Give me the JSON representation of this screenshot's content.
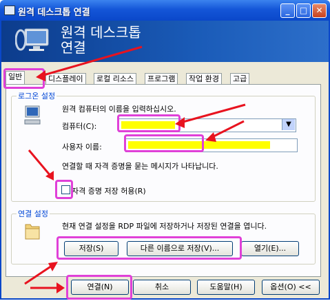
{
  "window": {
    "title": "원격 데스크톱 연결",
    "minimize": "_",
    "maximize": "□",
    "close": "✕"
  },
  "banner": {
    "title": "원격 데스크톱\n연결"
  },
  "tabs": [
    {
      "label": "일반"
    },
    {
      "label": "디스플레이"
    },
    {
      "label": "로컬 리소스"
    },
    {
      "label": "프로그램"
    },
    {
      "label": "작업 환경"
    },
    {
      "label": "고급"
    }
  ],
  "logon": {
    "group_title": "로그온 설정",
    "instruction": "원격 컴퓨터의 이름을 입력하십시오.",
    "computer_label": "컴퓨터(C):",
    "computer_value": "",
    "username_label": "사용자 이름:",
    "username_value": "",
    "credential_note": "연결할 때 자격 증명을 묻는 메시지가 나타납니다.",
    "allow_save_label": "자격 증명 저장 허용(R)",
    "allow_save_checked": false
  },
  "connection": {
    "group_title": "연결 설정",
    "description": "현재 연결 설정을 RDP 파일에 저장하거나 저장된 연결을 엽니다.",
    "save_label": "저장(S)",
    "save_as_label": "다른 이름으로 저장(V)...",
    "open_label": "열기(E)..."
  },
  "footer": {
    "connect_label": "연결(N)",
    "cancel_label": "취소",
    "help_label": "도움말(H)",
    "options_label": "옵션(O) <<"
  },
  "colors": {
    "highlight": "#e040d8",
    "arrow": "#e8131f",
    "marker": "#ffff00"
  }
}
